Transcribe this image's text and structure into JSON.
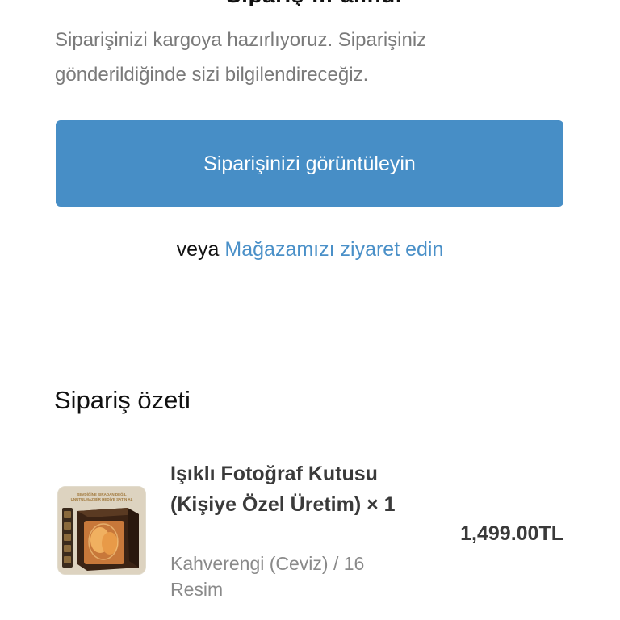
{
  "header": {
    "clipped_title": "Sipariş … alındı"
  },
  "intro": {
    "text": "Siparişinizi kargoya hazırlıyoruz. Siparişiniz gönderildiğinde sizi bilgilendireceğiz."
  },
  "actions": {
    "view_order_label": "Siparişinizi görüntüleyin",
    "or_label": "veya",
    "visit_store_label": "Mağazamızı ziyaret edin"
  },
  "summary": {
    "heading": "Sipariş özeti",
    "items": [
      {
        "name": "Işıklı Fotoğraf Kutusu (Kişiye Özel Üretim) × 1",
        "variant": "Kahverengi (Ceviz) / 16 Resim",
        "price": "1,499.00TL",
        "image_icon": "product-photo-box-image",
        "image_banner_text": "SEVDİĞİNE SIRADAN DEĞİL UNUTULMAZ BİR HEDİYE SATIN AL"
      }
    ]
  },
  "colors": {
    "primary_button": "#478ec6",
    "link": "#4a90c8",
    "muted_text": "#7a7a7a"
  }
}
